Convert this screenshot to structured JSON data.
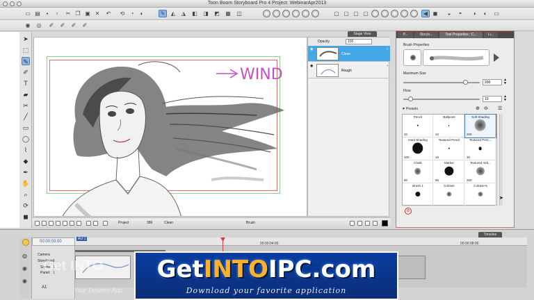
{
  "window": {
    "title": "Toon Boom Storyboard Pro 4 Project: WebinarApr2013"
  },
  "stage": {
    "tab_label": "Stage View",
    "annotation": "WIND"
  },
  "layers": {
    "opacity_label": "Opacity",
    "opacity_value": "100",
    "items": [
      {
        "name": "Clean",
        "selected": true
      },
      {
        "name": "Rough",
        "selected": false
      }
    ]
  },
  "stage_bar": {
    "project_label": "Project",
    "zoom_label": "386",
    "layer_label": "Clean",
    "tool_label": "Brush"
  },
  "properties": {
    "tabs": [
      "P...",
      "Storyb...",
      "Tool Properties : C...",
      "Li..."
    ],
    "active_tab": 2,
    "brush_properties_label": "Brush Properties",
    "max_size_label": "Maximum Size",
    "max_size_value": "200",
    "max_size_fraction": 0.82,
    "flow_label": "Flow",
    "flow_value": "10",
    "flow_fraction": 0.1,
    "presets_label": "Presets",
    "presets": [
      {
        "name": "Pencil",
        "size": "20",
        "dot": 2,
        "dark": true
      },
      {
        "name": "Ballpoint",
        "size": "10",
        "dot": 1.5,
        "dark": true
      },
      {
        "name": "Soft Shading",
        "size": "200",
        "dot": 14,
        "dark": false,
        "selected": true
      },
      {
        "name": "Hard Shading",
        "size": "200",
        "dot": 13,
        "dark": true
      },
      {
        "name": "Textured Pencil",
        "size": "15",
        "dot": 2,
        "dark": true
      },
      {
        "name": "Textured Penc...",
        "size": "30",
        "dot": 4,
        "dark": true
      },
      {
        "name": "Chalk",
        "size": "80",
        "dot": 8,
        "dark": false
      },
      {
        "name": "Marker",
        "size": "95",
        "dot": 11,
        "dark": true
      },
      {
        "name": "Textured Airb...",
        "size": "250",
        "dot": 10,
        "dark": false
      },
      {
        "name": "Brush 1",
        "size": "",
        "dot": 6,
        "dark": true
      },
      {
        "name": "Colrase",
        "size": "",
        "dot": 6,
        "dark": false
      },
      {
        "name": "Colrase-5",
        "size": "",
        "dot": 6,
        "dark": false
      }
    ]
  },
  "timeline": {
    "tab_label": "Timeline",
    "current_time": "00:00:03:00",
    "ruler_marks": [
      "00:00:04:00",
      "00:00:08:00"
    ],
    "act_label": "Act 1",
    "track_names": [
      "Camera",
      "Storyboard",
      "Scene:",
      "Panel:",
      "A1"
    ],
    "scene_value": "1",
    "panel_value": "1"
  },
  "watermark": {
    "main_prefix": "Get",
    "main_accent": "INTO",
    "main_suffix": "IPC",
    "main_domain": ".com",
    "subtitle": "Download your favorite application",
    "ghost_left": "Get INTO",
    "ghost_bottom": "Your Desired App"
  },
  "colors": {
    "selected_layer": "#43a7e8",
    "frame_red": "#e36b6b",
    "frame_green": "#8fd18f",
    "annotation": "#c94fc9",
    "banner_blue": "#0a3c9e"
  }
}
